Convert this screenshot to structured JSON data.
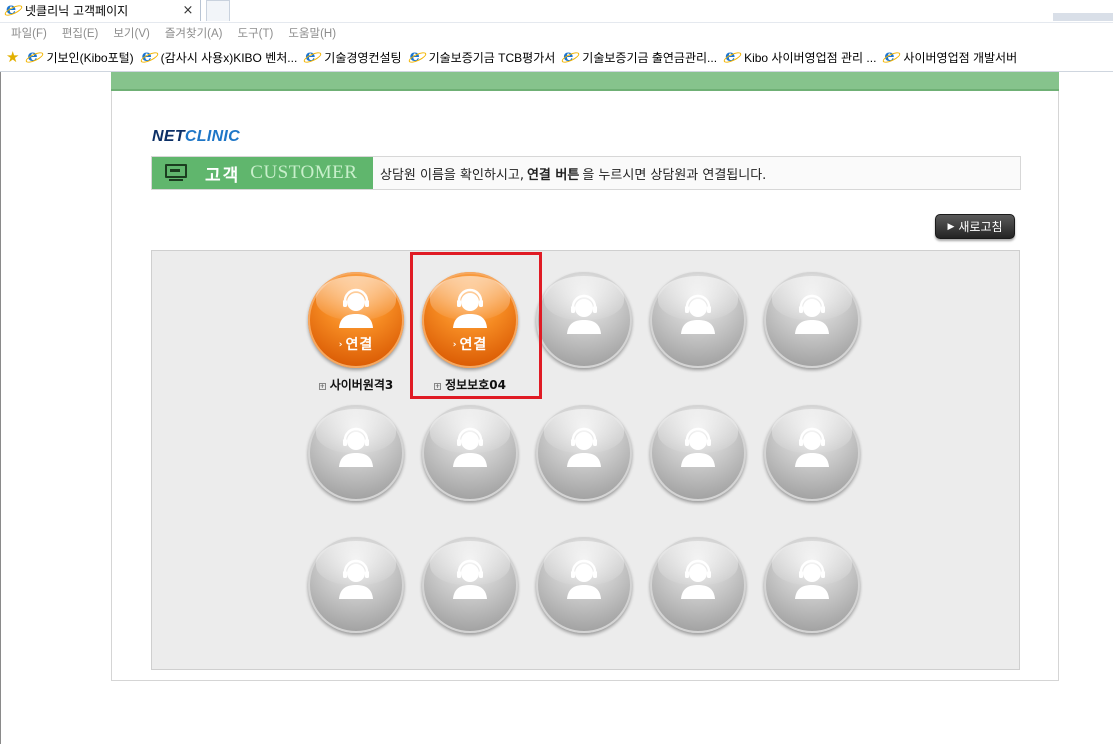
{
  "browser": {
    "tab_title": "넷클리닉 고객페이지",
    "close_glyph": "×",
    "menu": [
      "파일(F)",
      "편집(E)",
      "보기(V)",
      "즐겨찾기(A)",
      "도구(T)",
      "도움말(H)"
    ],
    "favorites": [
      "기보인(Kibo포털)",
      "(감사시 사용x)KIBO 벤처...",
      "기술경영컨설팅",
      "기술보증기금 TCB평가서",
      "기술보증기금 출연금관리...",
      "Kibo 사이버영업점 관리 ...",
      "사이버영업점 개발서버"
    ]
  },
  "page": {
    "logo_net": "NET",
    "logo_clinic": "CLINIC",
    "title_kr": "고객",
    "title_en": "CUSTOMER",
    "desc_before": "상담원 이름을 확인하시고,",
    "desc_bold": "연결 버튼",
    "desc_after": "을 누르시면 상담원과 연결됩니다.",
    "refresh_label": "새로고침",
    "connect_label": "연결",
    "agents": [
      {
        "name": "사이버원격3",
        "online": true
      },
      {
        "name": "정보보호04",
        "online": true
      }
    ]
  },
  "colors": {
    "accent_green": "#60b66d",
    "online_orange": "#f58a22",
    "highlight_red": "#e01b24"
  }
}
